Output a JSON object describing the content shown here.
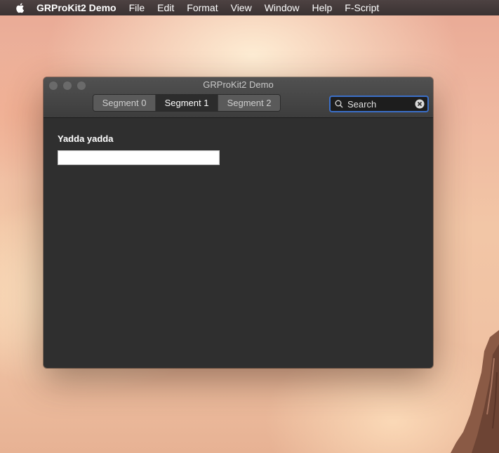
{
  "menubar": {
    "apple_icon": "apple-logo-icon",
    "app_name": "GRProKit2 Demo",
    "items": [
      "File",
      "Edit",
      "Format",
      "View",
      "Window",
      "Help",
      "F-Script"
    ]
  },
  "window": {
    "title": "GRProKit2 Demo",
    "segments": [
      "Segment 0",
      "Segment 1",
      "Segment 2"
    ],
    "selected_segment": "Segment 1",
    "search": {
      "placeholder": "Search",
      "value": ""
    },
    "content": {
      "label": "Yadda yadda",
      "field_value": ""
    }
  },
  "colors": {
    "window_bg": "#2f2f2f",
    "focus_ring": "#3b6fc7",
    "menubar_bg": "#3a3232"
  }
}
